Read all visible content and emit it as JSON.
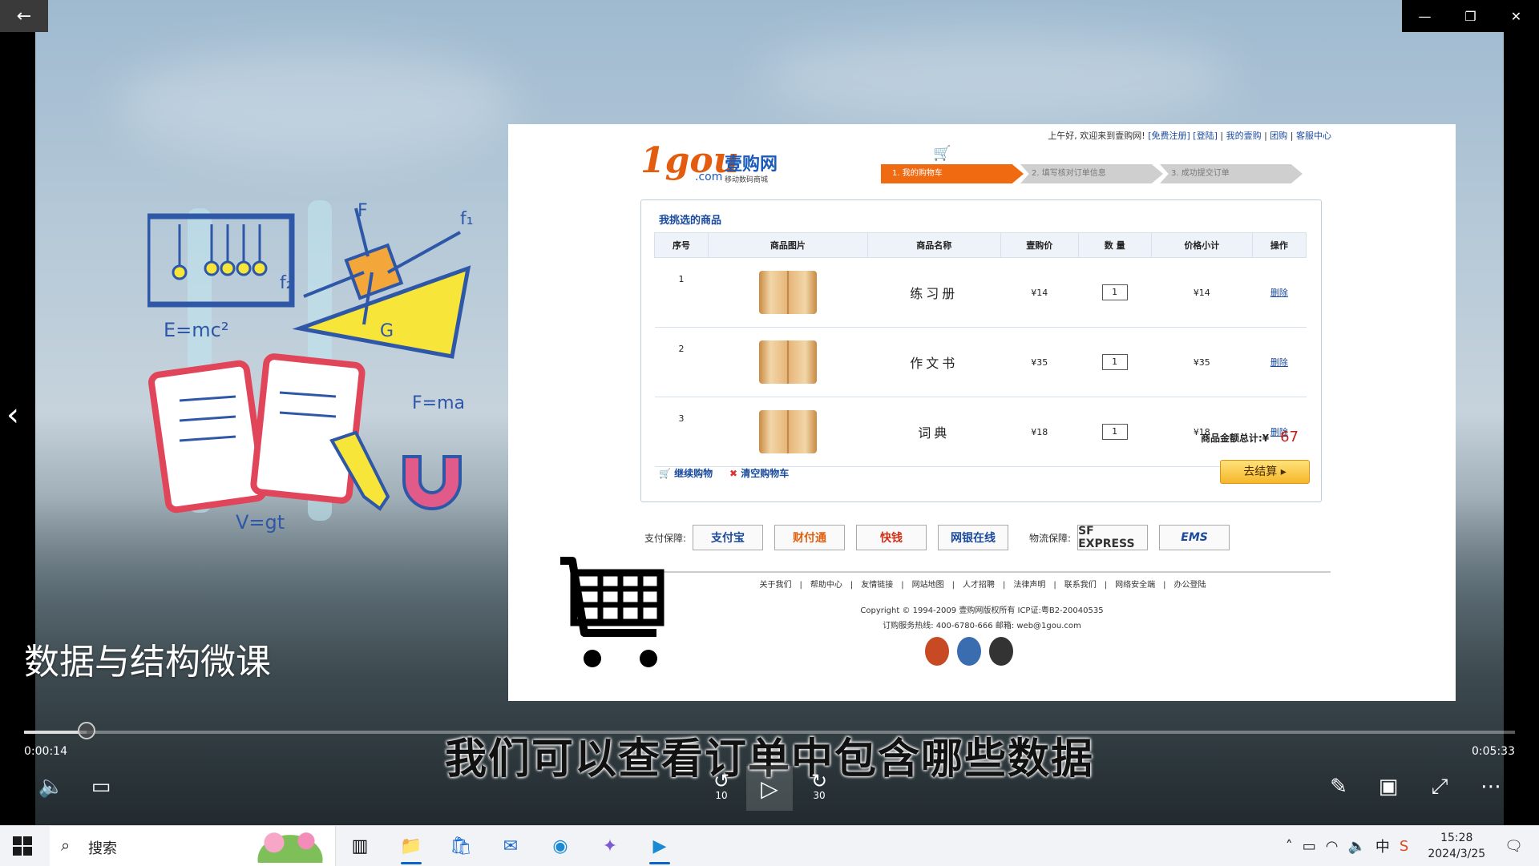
{
  "player": {
    "course_title": "数据与结构微课",
    "subtitle": "我们可以查看订单中包含哪些数据",
    "time_current": "0:00:14",
    "time_total": "0:05:33",
    "progress_fraction": 0.042,
    "rewind_label": "10",
    "forward_label": "30"
  },
  "shop": {
    "top_links": {
      "greeting": "上午好, 欢迎来到壹购网!",
      "register": "[免费注册]",
      "login": "[登陆]",
      "my_orders": "我的壹购",
      "group": "团购",
      "service": "客服中心"
    },
    "logo": {
      "mark": "1gou",
      "com": ".com",
      "name_zh": "壹购网",
      "tagline": "移动数码商城"
    },
    "steps": [
      "1. 我的购物车",
      "2. 填写核对订单信息",
      "3. 成功提交订单"
    ],
    "panel_title": "我挑选的商品",
    "columns": [
      "序号",
      "商品图片",
      "商品名称",
      "壹购价",
      "数 量",
      "价格小计",
      "操作"
    ],
    "rows": [
      {
        "no": "1",
        "name": "练习册",
        "price": "¥14",
        "qty": "1",
        "subtotal": "¥14",
        "action": "删除"
      },
      {
        "no": "2",
        "name": "作文书",
        "price": "¥35",
        "qty": "1",
        "subtotal": "¥35",
        "action": "删除"
      },
      {
        "no": "3",
        "name": "词典",
        "price": "¥18",
        "qty": "1",
        "subtotal": "¥18",
        "action": "删除"
      }
    ],
    "total_label": "商品金额总计:¥",
    "total_amount": "67",
    "continue_shopping": "继续购物",
    "clear_cart": "清空购物车",
    "checkout": "去结算",
    "pay_label": "支付保障:",
    "pay_methods": [
      "支付宝",
      "财付通",
      "快钱",
      "网银在线"
    ],
    "logistics_label": "物流保障:",
    "logistics": [
      "SF EXPRESS",
      "EMS"
    ],
    "footer_links": [
      "关于我们",
      "帮助中心",
      "友情链接",
      "网站地图",
      "人才招聘",
      "法律声明",
      "联系我们",
      "网络安全端",
      "办公登陆"
    ],
    "copyright": "Copyright © 1994-2009 壹购网版权所有 ICP证:粤B2-20040535",
    "hotline": "订购服务热线: 400-6780-666 邮箱: web@1gou.com"
  },
  "taskbar": {
    "search_placeholder": "搜索",
    "time": "15:28",
    "date": "2024/3/25",
    "ime": "中"
  },
  "colors": {
    "step_active": "#f06a12",
    "price": "#d2401f",
    "link": "#1a4a9c",
    "accent": "#0a63c9"
  }
}
